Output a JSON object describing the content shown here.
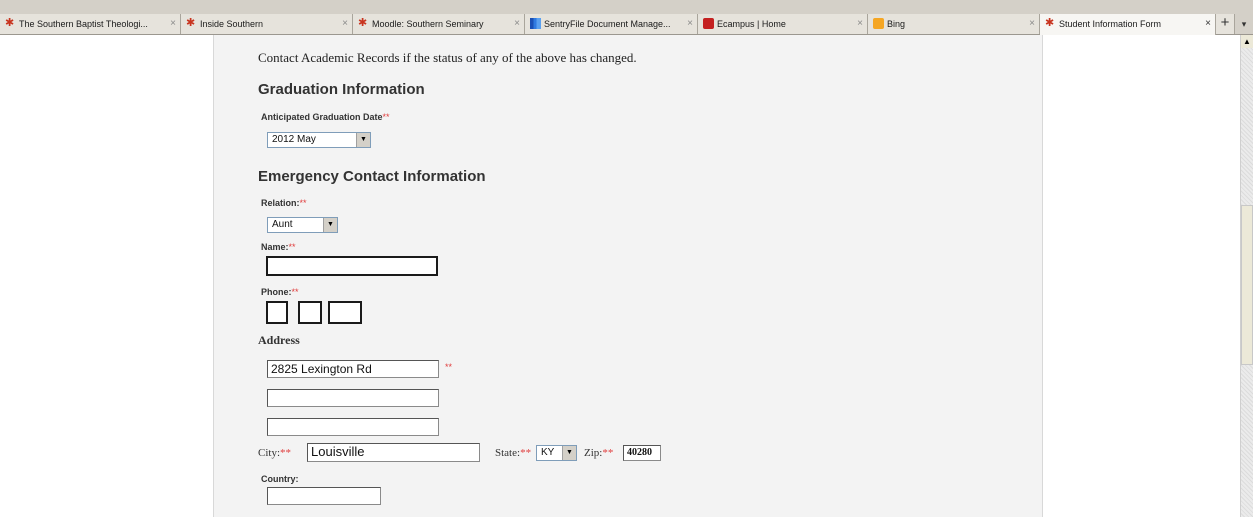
{
  "browser": {
    "tabs": [
      {
        "label": "The Southern Baptist Theologi...",
        "icon": "seminary-star-icon"
      },
      {
        "label": "Inside Southern",
        "icon": "seminary-star-icon"
      },
      {
        "label": "Moodle: Southern Seminary",
        "icon": "seminary-star-icon"
      },
      {
        "label": "SentryFile Document Manage...",
        "icon": "sentryfile-chart-icon"
      },
      {
        "label": "Ecampus | Home",
        "icon": "ecampus-icon"
      },
      {
        "label": "Bing",
        "icon": "bing-icon"
      },
      {
        "label": "Student Information Form",
        "icon": "seminary-star-icon",
        "active": true
      }
    ],
    "close_glyph": "×",
    "new_tab_glyph": "+",
    "menu_glyph": "▾"
  },
  "form": {
    "records_note": "Contact Academic Records if the status of any of the above has changed.",
    "graduation": {
      "heading": "Graduation Information",
      "date_label": "Anticipated Graduation Date",
      "date_value": "2012 May"
    },
    "emergency": {
      "heading": "Emergency Contact Information",
      "relation_label": "Relation:",
      "relation_value": "Aunt",
      "name_label": "Name:",
      "name_value": "",
      "phone_label": "Phone:"
    },
    "address": {
      "heading": "Address",
      "line1": "2825 Lexington Rd",
      "line2": "",
      "line3": "",
      "city_label": "City:",
      "city_value": "Louisville",
      "state_label": "State:",
      "state_value": "KY",
      "zip_label": "Zip:",
      "zip_value": "40280",
      "country_label": "Country:",
      "country_value": ""
    },
    "required_marker": "**"
  },
  "colors": {
    "required": "#e03c3c",
    "form_background": "#f3f3f3"
  }
}
